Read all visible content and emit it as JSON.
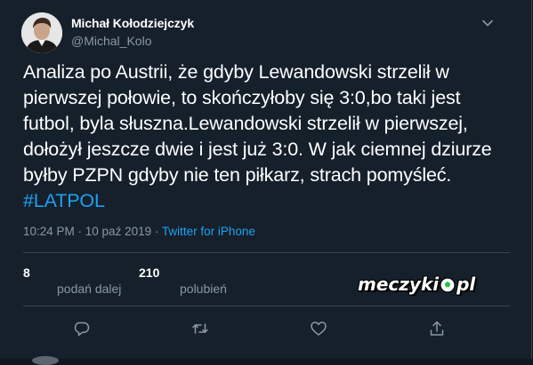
{
  "author": {
    "name": "Michał Kołodziejczyk",
    "handle": "@Michal_Kolo"
  },
  "tweet": {
    "text": "Analiza po Austrii, że gdyby Lewandowski strzelił w pierwszej połowie, to skończyłoby się 3:0,bo taki jest futbol, byla słuszna.Lewandowski strzelił w pierwszej, dołożył jeszcze dwie i jest już 3:0. W jak ciemnej dziurze byłby PZPN gdyby nie ten piłkarz, strach pomyśleć.",
    "hashtag": "#LATPOL"
  },
  "meta": {
    "timestamp": "10:24 PM · 10 paź 2019",
    "separator": " · ",
    "source": "Twitter for iPhone"
  },
  "stats": {
    "retweets_count": "8",
    "retweets_label": "podań dalej",
    "likes_count": "210",
    "likes_label": "polubień"
  },
  "watermark": {
    "left": "meczyki",
    "right": "pl"
  },
  "actions": [
    "reply-icon",
    "retweet-icon",
    "like-icon",
    "share-icon"
  ],
  "colors": {
    "background": "#15202b",
    "text": "#ffffff",
    "muted": "#8899a6",
    "accent": "#1da1f2",
    "divider": "#38444d"
  }
}
